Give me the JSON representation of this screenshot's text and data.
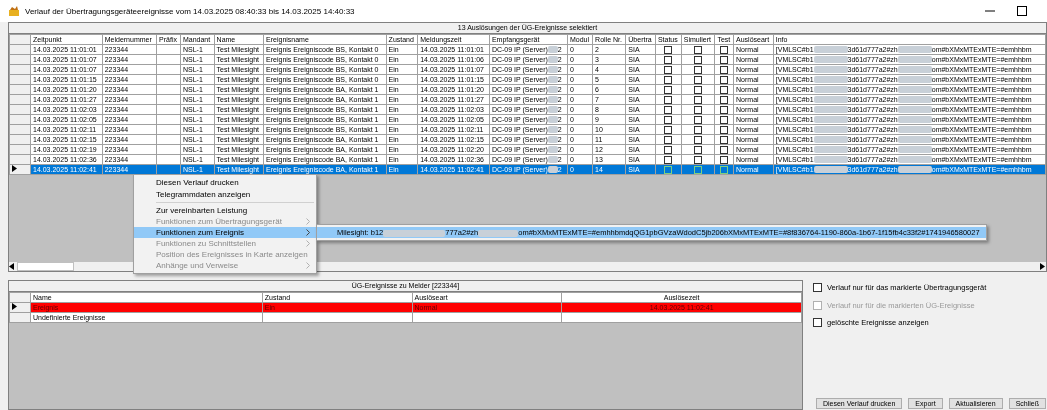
{
  "window": {
    "title": "Verlauf der Übertragungsgeräteereignisse vom 14.03.2025 08:40:33 bis 14.03.2025 14:40:33"
  },
  "events_grid": {
    "caption": "13 Auslösungen der ÜG-Ereignisse selektiert",
    "columns": [
      "Zeitpunkt",
      "Meldernummer",
      "Präfix",
      "Mandant",
      "Name",
      "Ereignisname",
      "Zustand",
      "Meldungszeit",
      "Empfangsgerät",
      "Modul",
      "Rolle Nr.",
      "Übertra",
      "Status",
      "Simuliert",
      "Test",
      "Auslöseart",
      "Info"
    ],
    "rows": [
      {
        "zeitpunkt": "14.03.2025 11:01:01",
        "meldernummer": "223344",
        "mandant": "NSL-1",
        "name": "Test Milesight",
        "ereignisname": "Ereignis Ereigniscode BS, Kontakt 0",
        "zustand": "Ein",
        "meldungszeit": "14.03.2025 11:01:01",
        "empfangsgeraet": [
          "DC-09 IP (Server)",
          "2"
        ],
        "modul": "0",
        "rolle_nr": "2",
        "uebertragung": "SIA",
        "status": false,
        "simuliert": false,
        "test": false,
        "ausloeseart": "Normal",
        "info": [
          "[VMLSC#b1",
          "3d61d777a2#zh",
          "om#bXMxMTExMTE=#emhhbm"
        ],
        "selected": false
      },
      {
        "zeitpunkt": "14.03.2025 11:01:07",
        "meldernummer": "223344",
        "mandant": "NSL-1",
        "name": "Test Milesight",
        "ereignisname": "Ereignis Ereigniscode BS, Kontakt 0",
        "zustand": "Ein",
        "meldungszeit": "14.03.2025 11:01:06",
        "empfangsgeraet": [
          "DC-09 IP (Server)",
          "2"
        ],
        "modul": "0",
        "rolle_nr": "3",
        "uebertragung": "SIA",
        "status": false,
        "simuliert": false,
        "test": false,
        "ausloeseart": "Normal",
        "info": [
          "[VMLSC#b1",
          "3d61d777a2#zh",
          "om#bXMxMTExMTE=#emhhbm"
        ],
        "selected": false
      },
      {
        "zeitpunkt": "14.03.2025 11:01:07",
        "meldernummer": "223344",
        "mandant": "NSL-1",
        "name": "Test Milesight",
        "ereignisname": "Ereignis Ereigniscode BS, Kontakt 0",
        "zustand": "Ein",
        "meldungszeit": "14.03.2025 11:01:07",
        "empfangsgeraet": [
          "DC-09 IP (Server)",
          "2"
        ],
        "modul": "0",
        "rolle_nr": "4",
        "uebertragung": "SIA",
        "status": false,
        "simuliert": false,
        "test": false,
        "ausloeseart": "Normal",
        "info": [
          "[VMLSC#b1",
          "3d61d777a2#zh",
          "om#bXMxMTExMTE=#emhhbm"
        ],
        "selected": false
      },
      {
        "zeitpunkt": "14.03.2025 11:01:15",
        "meldernummer": "223344",
        "mandant": "NSL-1",
        "name": "Test Milesight",
        "ereignisname": "Ereignis Ereigniscode BS, Kontakt 0",
        "zustand": "Ein",
        "meldungszeit": "14.03.2025 11:01:15",
        "empfangsgeraet": [
          "DC-09 IP (Server)",
          "2"
        ],
        "modul": "0",
        "rolle_nr": "5",
        "uebertragung": "SIA",
        "status": false,
        "simuliert": false,
        "test": false,
        "ausloeseart": "Normal",
        "info": [
          "[VMLSC#b1",
          "3d61d777a2#zh",
          "om#bXMxMTExMTE=#emhhbm"
        ],
        "selected": false
      },
      {
        "zeitpunkt": "14.03.2025 11:01:20",
        "meldernummer": "223344",
        "mandant": "NSL-1",
        "name": "Test Milesight",
        "ereignisname": "Ereignis Ereigniscode BA, Kontakt 1",
        "zustand": "Ein",
        "meldungszeit": "14.03.2025 11:01:20",
        "empfangsgeraet": [
          "DC-09 IP (Server)",
          "2"
        ],
        "modul": "0",
        "rolle_nr": "6",
        "uebertragung": "SIA",
        "status": false,
        "simuliert": false,
        "test": false,
        "ausloeseart": "Normal",
        "info": [
          "[VMLSC#b1",
          "3d61d777a2#zh",
          "om#bXMxMTExMTE=#emhhbm"
        ],
        "selected": false
      },
      {
        "zeitpunkt": "14.03.2025 11:01:27",
        "meldernummer": "223344",
        "mandant": "NSL-1",
        "name": "Test Milesight",
        "ereignisname": "Ereignis Ereigniscode BA, Kontakt 1",
        "zustand": "Ein",
        "meldungszeit": "14.03.2025 11:01:27",
        "empfangsgeraet": [
          "DC-09 IP (Server)",
          "2"
        ],
        "modul": "0",
        "rolle_nr": "7",
        "uebertragung": "SIA",
        "status": false,
        "simuliert": false,
        "test": false,
        "ausloeseart": "Normal",
        "info": [
          "[VMLSC#b1",
          "3d61d777a2#zh",
          "om#bXMxMTExMTE=#emhhbm"
        ],
        "selected": false
      },
      {
        "zeitpunkt": "14.03.2025 11:02:03",
        "meldernummer": "223344",
        "mandant": "NSL-1",
        "name": "Test Milesight",
        "ereignisname": "Ereignis Ereigniscode BS, Kontakt 1",
        "zustand": "Ein",
        "meldungszeit": "14.03.2025 11:02:03",
        "empfangsgeraet": [
          "DC-09 IP (Server)",
          "2"
        ],
        "modul": "0",
        "rolle_nr": "8",
        "uebertragung": "SIA",
        "status": false,
        "simuliert": false,
        "test": false,
        "ausloeseart": "Normal",
        "info": [
          "[VMLSC#b1",
          "3d61d777a2#zh",
          "om#bXMxMTExMTE=#emhhbm"
        ],
        "selected": false
      },
      {
        "zeitpunkt": "14.03.2025 11:02:05",
        "meldernummer": "223344",
        "mandant": "NSL-1",
        "name": "Test Milesight",
        "ereignisname": "Ereignis Ereigniscode BS, Kontakt 1",
        "zustand": "Ein",
        "meldungszeit": "14.03.2025 11:02:05",
        "empfangsgeraet": [
          "DC-09 IP (Server)",
          "2"
        ],
        "modul": "0",
        "rolle_nr": "9",
        "uebertragung": "SIA",
        "status": false,
        "simuliert": false,
        "test": false,
        "ausloeseart": "Normal",
        "info": [
          "[VMLSC#b1",
          "3d61d777a2#zh",
          "om#bXMxMTExMTE=#emhhbm"
        ],
        "selected": false
      },
      {
        "zeitpunkt": "14.03.2025 11:02:11",
        "meldernummer": "223344",
        "mandant": "NSL-1",
        "name": "Test Milesight",
        "ereignisname": "Ereignis Ereigniscode BS, Kontakt 1",
        "zustand": "Ein",
        "meldungszeit": "14.03.2025 11:02:11",
        "empfangsgeraet": [
          "DC-09 IP (Server)",
          "2"
        ],
        "modul": "0",
        "rolle_nr": "10",
        "uebertragung": "SIA",
        "status": false,
        "simuliert": false,
        "test": false,
        "ausloeseart": "Normal",
        "info": [
          "[VMLSC#b1",
          "3d61d777a2#zh",
          "om#bXMxMTExMTE=#emhhbm"
        ],
        "selected": false
      },
      {
        "zeitpunkt": "14.03.2025 11:02:15",
        "meldernummer": "223344",
        "mandant": "NSL-1",
        "name": "Test Milesight",
        "ereignisname": "Ereignis Ereigniscode BA, Kontakt 1",
        "zustand": "Ein",
        "meldungszeit": "14.03.2025 11:02:15",
        "empfangsgeraet": [
          "DC-09 IP (Server)",
          "2"
        ],
        "modul": "0",
        "rolle_nr": "11",
        "uebertragung": "SIA",
        "status": false,
        "simuliert": false,
        "test": false,
        "ausloeseart": "Normal",
        "info": [
          "[VMLSC#b1",
          "3d61d777a2#zh",
          "om#bXMxMTExMTE=#emhhbm"
        ],
        "selected": false
      },
      {
        "zeitpunkt": "14.03.2025 11:02:19",
        "meldernummer": "223344",
        "mandant": "NSL-1",
        "name": "Test Milesight",
        "ereignisname": "Ereignis Ereigniscode BA, Kontakt 1",
        "zustand": "Ein",
        "meldungszeit": "14.03.2025 11:02:20",
        "empfangsgeraet": [
          "DC-09 IP (Server)",
          "2"
        ],
        "modul": "0",
        "rolle_nr": "12",
        "uebertragung": "SIA",
        "status": false,
        "simuliert": false,
        "test": false,
        "ausloeseart": "Normal",
        "info": [
          "[VMLSC#b1",
          "3d61d777a2#zh",
          "om#bXMxMTExMTE=#emhhbm"
        ],
        "selected": false
      },
      {
        "zeitpunkt": "14.03.2025 11:02:36",
        "meldernummer": "223344",
        "mandant": "NSL-1",
        "name": "Test Milesight",
        "ereignisname": "Ereignis Ereigniscode BA, Kontakt 1",
        "zustand": "Ein",
        "meldungszeit": "14.03.2025 11:02:36",
        "empfangsgeraet": [
          "DC-09 IP (Server)",
          "2"
        ],
        "modul": "0",
        "rolle_nr": "13",
        "uebertragung": "SIA",
        "status": false,
        "simuliert": false,
        "test": false,
        "ausloeseart": "Normal",
        "info": [
          "[VMLSC#b1",
          "3d61d777a2#zh",
          "om#bXMxMTExMTE=#emhhbm"
        ],
        "selected": false
      },
      {
        "zeitpunkt": "14.03.2025 11:02:41",
        "meldernummer": "223344",
        "mandant": "NSL-1",
        "name": "Test Milesight",
        "ereignisname": "Ereignis Ereigniscode BA, Kontakt 1",
        "zustand": "Ein",
        "meldungszeit": "14.03.2025 11:02:41",
        "empfangsgeraet": [
          "DC-09 IP (Server)",
          "2"
        ],
        "modul": "0",
        "rolle_nr": "14",
        "uebertragung": "SIA",
        "status": false,
        "simuliert": false,
        "test": false,
        "ausloeseart": "Normal",
        "info": [
          "[VMLSC#b1",
          "3d61d777a2#zh",
          "om#bXMxMTExMTE=#emhhbm"
        ],
        "selected": true
      }
    ]
  },
  "context_menu": {
    "items": [
      {
        "label": "Diesen Verlauf drucken",
        "disabled": false,
        "selected": false,
        "submenu": false,
        "separator_after": false
      },
      {
        "label": "Telegrammdaten anzeigen",
        "disabled": false,
        "selected": false,
        "submenu": false,
        "separator_after": true
      },
      {
        "label": "Zur vereinbarten Leistung",
        "disabled": false,
        "selected": false,
        "submenu": false,
        "separator_after": false
      },
      {
        "label": "Funktionen zum Übertragungsgerät",
        "disabled": true,
        "selected": false,
        "submenu": true,
        "separator_after": false
      },
      {
        "label": "Funktionen zum Ereignis",
        "disabled": false,
        "selected": true,
        "submenu": true,
        "separator_after": false
      },
      {
        "label": "Funktionen zu Schnittstellen",
        "disabled": true,
        "selected": false,
        "submenu": true,
        "separator_after": false
      },
      {
        "label": "Position des Ereignisses in Karte anzeigen",
        "disabled": true,
        "selected": false,
        "submenu": false,
        "separator_after": false
      },
      {
        "label": "Anhänge und Verweise",
        "disabled": true,
        "selected": false,
        "submenu": true,
        "separator_after": false
      }
    ],
    "submenu": {
      "items": [
        {
          "parts": [
            "Milesight: b12",
            "777a2#zh",
            "om#bXMxMTExMTE=#emhhbmdqQG1pbGVzaWdodC5jb206bXMxMTExMTE=#8f836764-1190-860a-1b67-1f15fb4c33f2#1741946580027"
          ],
          "selected": true
        }
      ]
    }
  },
  "melder_grid": {
    "caption": "ÜG-Ereignisse zu Melder [223344]",
    "columns": [
      "Name",
      "Zustand",
      "Auslöseart",
      "Auslösezeit"
    ],
    "rows": [
      {
        "name": "Ereignis",
        "zustand": "Ein",
        "ausloeseart": "Normal",
        "ausloesezeit": "14.03.2025 11:02:41",
        "color": "#ff0000",
        "selected": true
      },
      {
        "name": "Undefinierte Ereignisse",
        "color": "#ffffff",
        "selected": false
      }
    ]
  },
  "options": [
    {
      "label": "Verlauf nur für das markierte Übertragungsgerät",
      "checked": false,
      "disabled": false
    },
    {
      "label": "Verlauf nur für die markierten ÜG-Ereignisse",
      "checked": false,
      "disabled": true
    },
    {
      "label": "gelöschte Ereignisse anzeigen",
      "checked": false,
      "disabled": false
    }
  ],
  "buttons": [
    "Diesen Verlauf drucken",
    "Export",
    "Aktualisieren",
    "Schließ"
  ]
}
